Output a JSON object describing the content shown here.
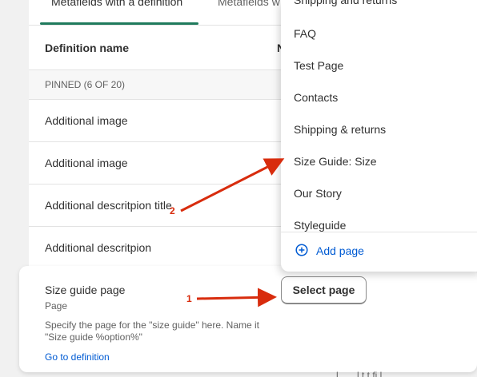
{
  "tabs": {
    "active": "Metafields with a definition",
    "other": "Metafields w"
  },
  "table": {
    "col_name": "Definition name",
    "col_second": "N",
    "pinned_label": "PINNED (6 OF 20)",
    "rows": [
      "Additional image",
      "Additional image",
      "Additional descritpion title",
      "Additional descritpion"
    ]
  },
  "card": {
    "title": "Size guide page",
    "subtitle": "Page",
    "description": "Specify the page for the \"size guide\" here. Name it \"Size guide %option%\"",
    "link": "Go to definition",
    "button": "Select page"
  },
  "dropdown": {
    "items": [
      "Shipping and returns",
      "FAQ",
      "Test Page",
      "Contacts",
      "Shipping & returns",
      "Size Guide: Size",
      "Our Story",
      "Styleguide"
    ],
    "add_label": "Add page",
    "add_icon": "plus-circle-icon"
  },
  "annotations": {
    "marker_1": "1",
    "marker_2": "2",
    "color": "#d82c0d"
  },
  "footer_fragment": "l... ...l t t fi l"
}
